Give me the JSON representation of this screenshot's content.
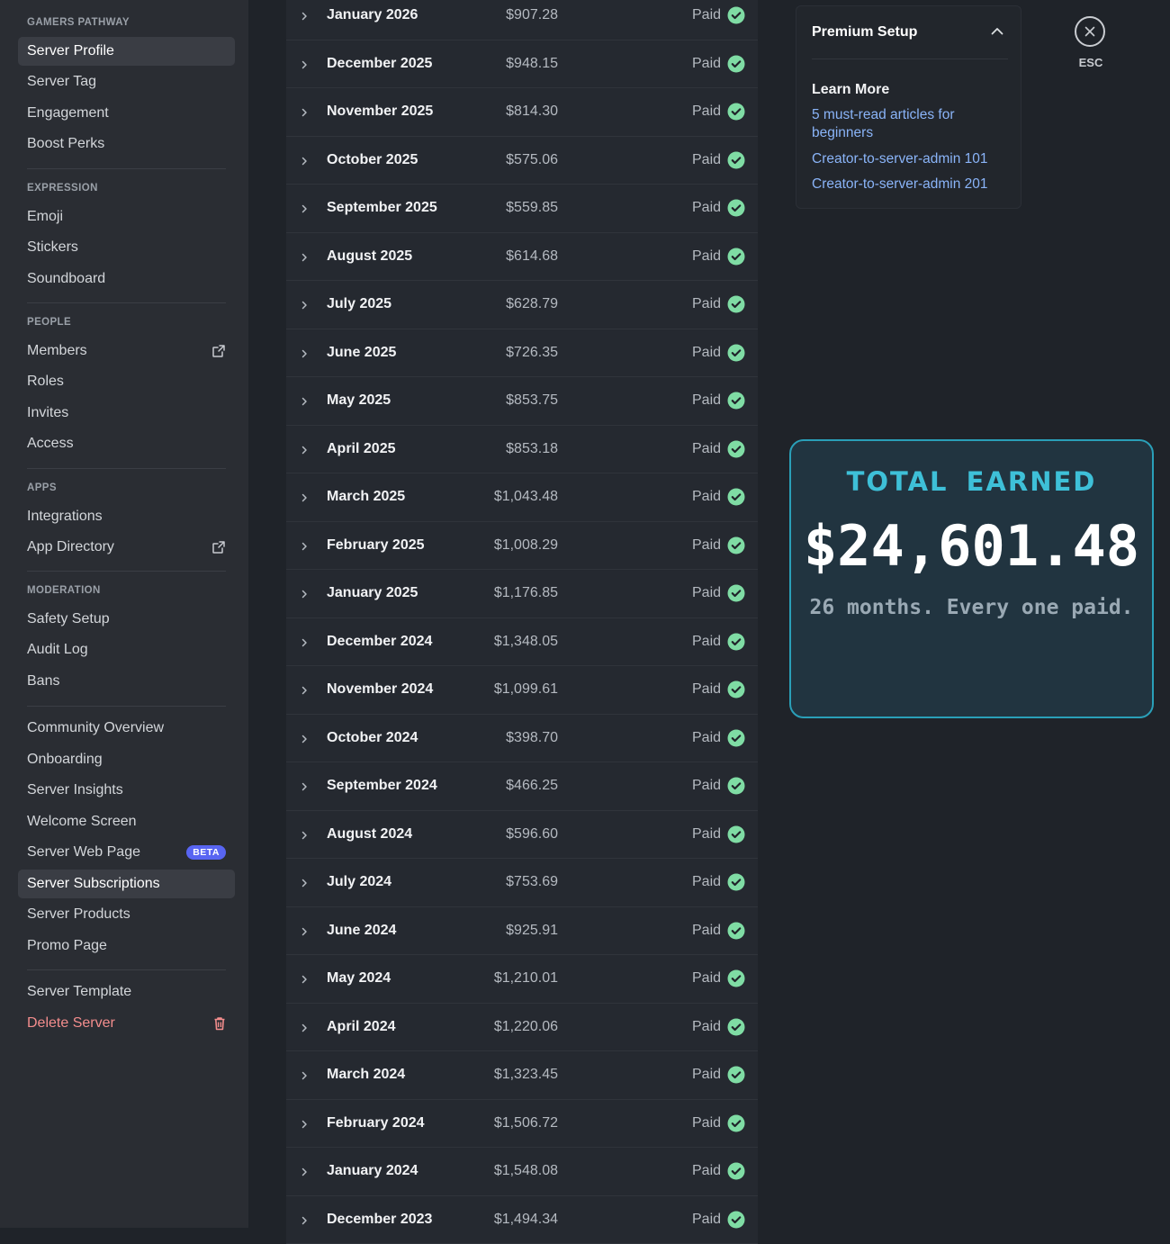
{
  "sidebar": {
    "sections": {
      "gamers_pathway": "GAMERS PATHWAY",
      "expression": "EXPRESSION",
      "people": "PEOPLE",
      "apps": "APPS",
      "moderation": "MODERATION"
    },
    "items": {
      "server_profile": "Server Profile",
      "server_tag": "Server Tag",
      "engagement": "Engagement",
      "boost_perks": "Boost Perks",
      "emoji": "Emoji",
      "stickers": "Stickers",
      "soundboard": "Soundboard",
      "members": "Members",
      "roles": "Roles",
      "invites": "Invites",
      "access": "Access",
      "integrations": "Integrations",
      "app_directory": "App Directory",
      "safety_setup": "Safety Setup",
      "audit_log": "Audit Log",
      "bans": "Bans",
      "community_overview": "Community Overview",
      "onboarding": "Onboarding",
      "server_insights": "Server Insights",
      "welcome_screen": "Welcome Screen",
      "server_web_page": "Server Web Page",
      "server_subscriptions": "Server Subscriptions",
      "server_products": "Server Products",
      "promo_page": "Promo Page",
      "server_template": "Server Template",
      "delete_server": "Delete Server"
    },
    "beta_badge": "BETA",
    "active_items": [
      "Server Profile",
      "Server Subscriptions"
    ]
  },
  "payouts": [
    {
      "month": "January 2026",
      "amount": "$907.28",
      "status": "Paid"
    },
    {
      "month": "December 2025",
      "amount": "$948.15",
      "status": "Paid"
    },
    {
      "month": "November 2025",
      "amount": "$814.30",
      "status": "Paid"
    },
    {
      "month": "October 2025",
      "amount": "$575.06",
      "status": "Paid"
    },
    {
      "month": "September 2025",
      "amount": "$559.85",
      "status": "Paid"
    },
    {
      "month": "August 2025",
      "amount": "$614.68",
      "status": "Paid"
    },
    {
      "month": "July 2025",
      "amount": "$628.79",
      "status": "Paid"
    },
    {
      "month": "June 2025",
      "amount": "$726.35",
      "status": "Paid"
    },
    {
      "month": "May 2025",
      "amount": "$853.75",
      "status": "Paid"
    },
    {
      "month": "April 2025",
      "amount": "$853.18",
      "status": "Paid"
    },
    {
      "month": "March 2025",
      "amount": "$1,043.48",
      "status": "Paid"
    },
    {
      "month": "February 2025",
      "amount": "$1,008.29",
      "status": "Paid"
    },
    {
      "month": "January 2025",
      "amount": "$1,176.85",
      "status": "Paid"
    },
    {
      "month": "December 2024",
      "amount": "$1,348.05",
      "status": "Paid"
    },
    {
      "month": "November 2024",
      "amount": "$1,099.61",
      "status": "Paid"
    },
    {
      "month": "October 2024",
      "amount": "$398.70",
      "status": "Paid"
    },
    {
      "month": "September 2024",
      "amount": "$466.25",
      "status": "Paid"
    },
    {
      "month": "August 2024",
      "amount": "$596.60",
      "status": "Paid"
    },
    {
      "month": "July 2024",
      "amount": "$753.69",
      "status": "Paid"
    },
    {
      "month": "June 2024",
      "amount": "$925.91",
      "status": "Paid"
    },
    {
      "month": "May 2024",
      "amount": "$1,210.01",
      "status": "Paid"
    },
    {
      "month": "April 2024",
      "amount": "$1,220.06",
      "status": "Paid"
    },
    {
      "month": "March 2024",
      "amount": "$1,323.45",
      "status": "Paid"
    },
    {
      "month": "February 2024",
      "amount": "$1,506.72",
      "status": "Paid"
    },
    {
      "month": "January 2024",
      "amount": "$1,548.08",
      "status": "Paid"
    },
    {
      "month": "December 2023",
      "amount": "$1,494.34",
      "status": "Paid"
    }
  ],
  "premium": {
    "title": "Premium Setup",
    "learn_more": "Learn More",
    "links": [
      "5 must-read articles for beginners",
      "Creator-to-server-admin 101",
      "Creator-to-server-admin 201"
    ]
  },
  "esc": {
    "label": "ESC"
  },
  "total": {
    "label": "TOTAL EARNED",
    "amount": "$24,601.48",
    "subtitle": "26 months. Every one paid."
  },
  "colors": {
    "paid_check": "#7fdca4",
    "link": "#8ab4f8",
    "danger": "#f38d8d",
    "beta": "#5865f2",
    "total_accent": "#3ec0d8"
  },
  "icons": {
    "row_expand": "chevron-right-icon",
    "status": "check-circle-icon",
    "external": "external-link-icon",
    "delete": "trash-icon",
    "collapse": "chevron-up-icon",
    "close": "close-icon"
  }
}
